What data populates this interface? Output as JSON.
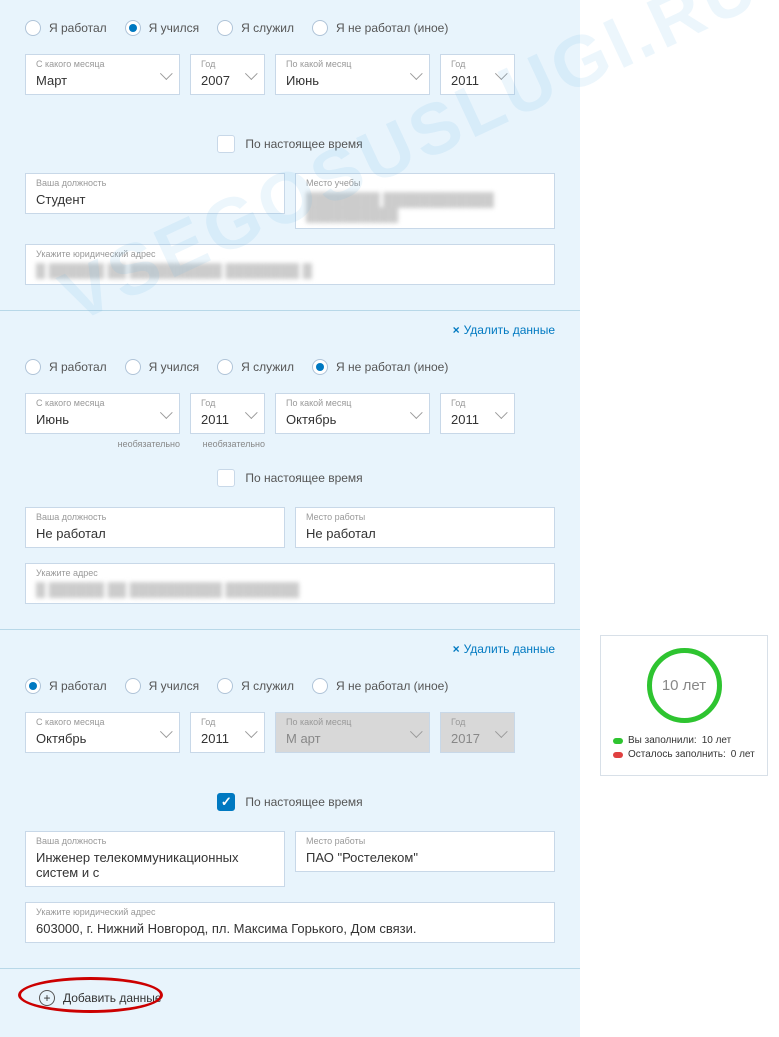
{
  "radios": {
    "worked": "Я работал",
    "studied": "Я учился",
    "served": "Я служил",
    "notworked": "Я не работал (иное)"
  },
  "labels": {
    "fromMonth": "С какого месяца",
    "year": "Год",
    "toMonth": "По какой месяц",
    "present": "По настоящее время",
    "position": "Ваша должность",
    "studyPlace": "Место учебы",
    "workPlace": "Место работы",
    "legalAddress": "Укажите юридический адрес",
    "address": "Укажите адрес",
    "optional": "необязательно",
    "delete": "Удалить данные",
    "add": "Добавить данные"
  },
  "months": {
    "march": "Март",
    "june": "Июнь",
    "october": "Октябрь",
    "martDisabled": "М арт"
  },
  "years": {
    "y2007": "2007",
    "y2011": "2011",
    "y2017": "2017"
  },
  "block1": {
    "position": "Студент",
    "place": "████████ ████████████ ██████████",
    "address": "█ ██████ ██ ██████████ ████████ █"
  },
  "block2": {
    "position": "Не работал",
    "place": "Не работал",
    "address": "█ ██████ ██ ██████████ ████████"
  },
  "block3": {
    "position": "Инженер телекоммуникационных систем и с",
    "place": "ПАО \"Ростелеком\"",
    "address": "603000, г. Нижний Новгород, пл. Максима Горького, Дом связи."
  },
  "side": {
    "circle": "10 лет",
    "filled": "Вы заполнили:",
    "filledVal": "10 лет",
    "remain": "Осталось заполнить:",
    "remainVal": "0 лет"
  },
  "watermark": "VSEGOSUSLUGI.RU"
}
